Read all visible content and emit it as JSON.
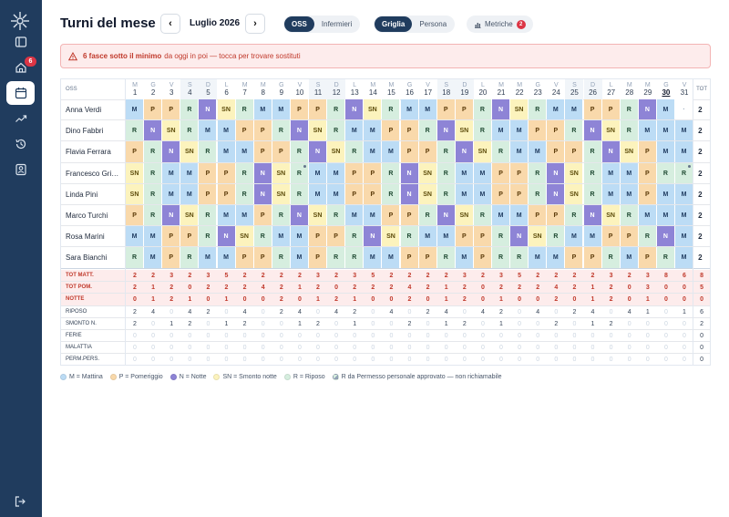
{
  "sidebar": {
    "badge": "6",
    "items": [
      {
        "icon": "panel-icon",
        "active": false
      },
      {
        "icon": "home-icon",
        "active": false
      },
      {
        "icon": "calendar-icon",
        "active": true
      },
      {
        "icon": "trend-icon",
        "active": false
      },
      {
        "icon": "history-icon",
        "active": false
      },
      {
        "icon": "profile-icon",
        "active": false
      }
    ]
  },
  "header": {
    "title": "Turni del mese",
    "prev": "‹",
    "next": "›",
    "month": "Luglio 2026",
    "role_tabs": [
      "OSS",
      "Infermieri"
    ],
    "role_active": 0,
    "view_tabs": [
      "Griglia",
      "Persona"
    ],
    "view_active": 0,
    "metrics_label": "Metriche",
    "metrics_count": "2"
  },
  "alert": {
    "bold": "6 fasce sotto il minimo",
    "text": "da oggi in poi — tocca per trovare sostituti"
  },
  "grid": {
    "col_header": "OSS",
    "tot_header": "TOT",
    "today_index": 29,
    "days": [
      {
        "dn": "M",
        "dd": "1"
      },
      {
        "dn": "G",
        "dd": "2"
      },
      {
        "dn": "V",
        "dd": "3"
      },
      {
        "dn": "S",
        "dd": "4"
      },
      {
        "dn": "D",
        "dd": "5"
      },
      {
        "dn": "L",
        "dd": "6"
      },
      {
        "dn": "M",
        "dd": "7"
      },
      {
        "dn": "M",
        "dd": "8"
      },
      {
        "dn": "G",
        "dd": "9"
      },
      {
        "dn": "V",
        "dd": "10"
      },
      {
        "dn": "S",
        "dd": "11"
      },
      {
        "dn": "D",
        "dd": "12"
      },
      {
        "dn": "L",
        "dd": "13"
      },
      {
        "dn": "M",
        "dd": "14"
      },
      {
        "dn": "M",
        "dd": "15"
      },
      {
        "dn": "G",
        "dd": "16"
      },
      {
        "dn": "V",
        "dd": "17"
      },
      {
        "dn": "S",
        "dd": "18"
      },
      {
        "dn": "D",
        "dd": "19"
      },
      {
        "dn": "L",
        "dd": "20"
      },
      {
        "dn": "M",
        "dd": "21"
      },
      {
        "dn": "M",
        "dd": "22"
      },
      {
        "dn": "G",
        "dd": "23"
      },
      {
        "dn": "V",
        "dd": "24"
      },
      {
        "dn": "S",
        "dd": "25"
      },
      {
        "dn": "D",
        "dd": "26"
      },
      {
        "dn": "L",
        "dd": "27"
      },
      {
        "dn": "M",
        "dd": "28"
      },
      {
        "dn": "M",
        "dd": "29"
      },
      {
        "dn": "G",
        "dd": "30"
      },
      {
        "dn": "V",
        "dd": "31"
      }
    ],
    "weekend_days": [
      3,
      4,
      10,
      11,
      17,
      18,
      24,
      25
    ],
    "rows": [
      {
        "name": "Anna Verdi",
        "tot": "2",
        "shifts": [
          "M",
          "P",
          "P",
          "R",
          "N",
          "SN",
          "R",
          "M",
          "M",
          "P",
          "P",
          "R",
          "N",
          "SN",
          "R",
          "M",
          "M",
          "P",
          "P",
          "R",
          "N",
          "SN",
          "R",
          "M",
          "M",
          "P",
          "P",
          "R",
          "N",
          "M",
          "·"
        ]
      },
      {
        "name": "Dino Fabbri",
        "tot": "2",
        "shifts": [
          "R",
          "N",
          "SN",
          "R",
          "M",
          "M",
          "P",
          "P",
          "R",
          "N",
          "SN",
          "R",
          "M",
          "M",
          "P",
          "P",
          "R",
          "N",
          "SN",
          "R",
          "M",
          "M",
          "P",
          "P",
          "R",
          "N",
          "SN",
          "R",
          "M",
          "M",
          "M"
        ]
      },
      {
        "name": "Flavia Ferrara",
        "tot": "2",
        "shifts": [
          "P",
          "R",
          "N",
          "SN",
          "R",
          "M",
          "M",
          "P",
          "P",
          "R",
          "N",
          "SN",
          "R",
          "M",
          "M",
          "P",
          "P",
          "R",
          "N",
          "SN",
          "R",
          "M",
          "M",
          "P",
          "P",
          "R",
          "N",
          "SN",
          "P",
          "M",
          "M"
        ]
      },
      {
        "name": "Francesco Grimaldi",
        "tot": "2",
        "shifts": [
          "SN",
          "R",
          "M",
          "M",
          "P",
          "P",
          "R",
          "N",
          "SN",
          "R",
          "M",
          "M",
          "P",
          "P",
          "R",
          "N",
          "SN",
          "R",
          "M",
          "M",
          "P",
          "P",
          "R",
          "N",
          "SN",
          "R",
          "M",
          "M",
          "P",
          "R",
          "R"
        ]
      },
      {
        "name": "Linda Pini",
        "tot": "2",
        "shifts": [
          "SN",
          "R",
          "M",
          "M",
          "P",
          "P",
          "R",
          "N",
          "SN",
          "R",
          "M",
          "M",
          "P",
          "P",
          "R",
          "N",
          "SN",
          "R",
          "M",
          "M",
          "P",
          "P",
          "R",
          "N",
          "SN",
          "R",
          "M",
          "M",
          "P",
          "M",
          "M"
        ]
      },
      {
        "name": "Marco Turchi",
        "tot": "2",
        "shifts": [
          "P",
          "R",
          "N",
          "SN",
          "R",
          "M",
          "M",
          "P",
          "R",
          "N",
          "SN",
          "R",
          "M",
          "M",
          "P",
          "P",
          "R",
          "N",
          "SN",
          "R",
          "M",
          "M",
          "P",
          "P",
          "R",
          "N",
          "SN",
          "R",
          "M",
          "M",
          "M"
        ]
      },
      {
        "name": "Rosa Marini",
        "tot": "2",
        "shifts": [
          "M",
          "M",
          "P",
          "P",
          "R",
          "N",
          "SN",
          "R",
          "M",
          "M",
          "P",
          "P",
          "R",
          "N",
          "SN",
          "R",
          "M",
          "M",
          "P",
          "P",
          "R",
          "N",
          "SN",
          "R",
          "M",
          "M",
          "P",
          "P",
          "R",
          "N",
          "M"
        ]
      },
      {
        "name": "Sara Bianchi",
        "tot": "2",
        "shifts": [
          "R",
          "M",
          "P",
          "R",
          "M",
          "M",
          "P",
          "P",
          "R",
          "M",
          "P",
          "R",
          "R",
          "M",
          "M",
          "P",
          "P",
          "R",
          "M",
          "P",
          "R",
          "R",
          "M",
          "M",
          "P",
          "P",
          "R",
          "M",
          "P",
          "R",
          "M"
        ]
      }
    ],
    "marked_cells": [
      [
        3,
        9
      ],
      [
        3,
        30
      ]
    ],
    "stats": [
      {
        "label": "TOT MATT.",
        "red": true,
        "tot": "8",
        "values": [
          "2",
          "2",
          "3",
          "2",
          "3",
          "5",
          "2",
          "2",
          "2",
          "2",
          "3",
          "2",
          "3",
          "5",
          "2",
          "2",
          "2",
          "2",
          "3",
          "2",
          "3",
          "5",
          "2",
          "2",
          "2",
          "2",
          "3",
          "2",
          "3",
          "8",
          "6"
        ]
      },
      {
        "label": "TOT POM.",
        "red": true,
        "tot": "5",
        "values": [
          "2",
          "1",
          "2",
          "0",
          "2",
          "2",
          "2",
          "4",
          "2",
          "1",
          "2",
          "0",
          "2",
          "2",
          "2",
          "4",
          "2",
          "1",
          "2",
          "0",
          "2",
          "2",
          "2",
          "4",
          "2",
          "1",
          "2",
          "0",
          "3",
          "0",
          "0"
        ]
      },
      {
        "label": "NOTTE",
        "red": true,
        "tot": "0",
        "values": [
          "0",
          "1",
          "2",
          "1",
          "0",
          "1",
          "0",
          "0",
          "2",
          "0",
          "1",
          "2",
          "1",
          "0",
          "0",
          "2",
          "0",
          "1",
          "2",
          "0",
          "1",
          "0",
          "0",
          "2",
          "0",
          "1",
          "2",
          "0",
          "1",
          "0",
          "0"
        ]
      },
      {
        "label": "RIPOSO",
        "red": false,
        "tot": "6",
        "values": [
          "2",
          "4",
          "0",
          "4",
          "2",
          "0",
          "4",
          "0",
          "2",
          "4",
          "0",
          "4",
          "2",
          "0",
          "4",
          "0",
          "2",
          "4",
          "0",
          "4",
          "2",
          "0",
          "4",
          "0",
          "2",
          "4",
          "0",
          "4",
          "1",
          "0",
          "1"
        ]
      },
      {
        "label": "SMONTO N.",
        "red": false,
        "tot": "2",
        "values": [
          "2",
          "0",
          "1",
          "2",
          "0",
          "1",
          "2",
          "0",
          "0",
          "1",
          "2",
          "0",
          "1",
          "0",
          "0",
          "2",
          "0",
          "1",
          "2",
          "0",
          "1",
          "0",
          "0",
          "2",
          "0",
          "1",
          "2",
          "0",
          "0",
          "0",
          "0"
        ]
      },
      {
        "label": "FERIE",
        "red": false,
        "tot": "0",
        "values": [
          "0",
          "0",
          "0",
          "0",
          "0",
          "0",
          "0",
          "0",
          "0",
          "0",
          "0",
          "0",
          "0",
          "0",
          "0",
          "0",
          "0",
          "0",
          "0",
          "0",
          "0",
          "0",
          "0",
          "0",
          "0",
          "0",
          "0",
          "0",
          "0",
          "0",
          "0"
        ]
      },
      {
        "label": "MALATTIA",
        "red": false,
        "tot": "0",
        "values": [
          "0",
          "0",
          "0",
          "0",
          "0",
          "0",
          "0",
          "0",
          "0",
          "0",
          "0",
          "0",
          "0",
          "0",
          "0",
          "0",
          "0",
          "0",
          "0",
          "0",
          "0",
          "0",
          "0",
          "0",
          "0",
          "0",
          "0",
          "0",
          "0",
          "0",
          "0"
        ]
      },
      {
        "label": "PERM.PERS.",
        "red": false,
        "tot": "0",
        "values": [
          "0",
          "0",
          "0",
          "0",
          "0",
          "0",
          "0",
          "0",
          "0",
          "0",
          "0",
          "0",
          "0",
          "0",
          "0",
          "0",
          "0",
          "0",
          "0",
          "0",
          "0",
          "0",
          "0",
          "0",
          "0",
          "0",
          "0",
          "0",
          "0",
          "0",
          "0"
        ]
      }
    ]
  },
  "legend": [
    {
      "code": "M",
      "text": "M = Mattina",
      "color": "#bcdcf5"
    },
    {
      "code": "P",
      "text": "P = Pomeriggio",
      "color": "#f9d9ab"
    },
    {
      "code": "N",
      "text": "N = Notte",
      "color": "#8e84d6"
    },
    {
      "code": "SN",
      "text": "SN = Smonto notte",
      "color": "#fcf3bd"
    },
    {
      "code": "R",
      "text": "R = Riposo",
      "color": "#d6eedf"
    },
    {
      "code": "RP",
      "text": "R da Permesso personale approvato — non richiamabile",
      "color": "#d6eedf"
    }
  ],
  "colors": {
    "sidebar": "#203c5e",
    "alert_text": "#c0392b",
    "badge": "#dc3545"
  }
}
